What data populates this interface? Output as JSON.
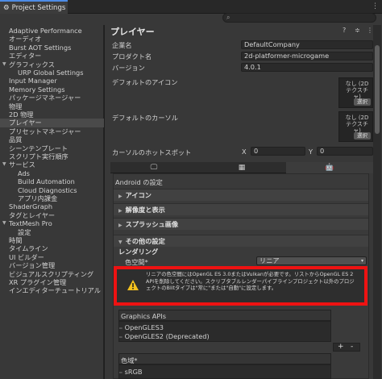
{
  "window": {
    "title": "Project Settings",
    "menu_icon": "kebab-menu-icon"
  },
  "search": {
    "placeholder": "",
    "icon": "search-icon"
  },
  "sidebar": {
    "items": [
      {
        "label": "Adaptive Performance",
        "indent": 0
      },
      {
        "label": "オーディオ",
        "indent": 0
      },
      {
        "label": "Burst AOT Settings",
        "indent": 0
      },
      {
        "label": "エディター",
        "indent": 0
      },
      {
        "label": "グラフィックス",
        "indent": 0,
        "expanded": true
      },
      {
        "label": "URP Global Settings",
        "indent": 2
      },
      {
        "label": "Input Manager",
        "indent": 0
      },
      {
        "label": "Memory Settings",
        "indent": 0
      },
      {
        "label": "パッケージマネージャー",
        "indent": 0
      },
      {
        "label": "物理",
        "indent": 0
      },
      {
        "label": "2D 物理",
        "indent": 0
      },
      {
        "label": "プレイヤー",
        "indent": 0,
        "active": true
      },
      {
        "label": "プリセットマネージャー",
        "indent": 0
      },
      {
        "label": "品質",
        "indent": 0
      },
      {
        "label": "シーンテンプレート",
        "indent": 0
      },
      {
        "label": "スクリプト実行順序",
        "indent": 0
      },
      {
        "label": "サービス",
        "indent": 0,
        "expanded": true
      },
      {
        "label": "Ads",
        "indent": 2
      },
      {
        "label": "Build Automation",
        "indent": 2
      },
      {
        "label": "Cloud Diagnostics",
        "indent": 2
      },
      {
        "label": "アプリ内課金",
        "indent": 2
      },
      {
        "label": "ShaderGraph",
        "indent": 0
      },
      {
        "label": "タグとレイヤー",
        "indent": 0
      },
      {
        "label": "TextMesh Pro",
        "indent": 0,
        "expanded": true
      },
      {
        "label": "設定",
        "indent": 2
      },
      {
        "label": "時間",
        "indent": 0
      },
      {
        "label": "タイムライン",
        "indent": 0
      },
      {
        "label": "UI ビルダー",
        "indent": 0
      },
      {
        "label": "バージョン管理",
        "indent": 0
      },
      {
        "label": "ビジュアルスクリプティング",
        "indent": 0
      },
      {
        "label": "XR プラグイン管理",
        "indent": 0
      },
      {
        "label": "インエディターチュートリアル",
        "indent": 0
      }
    ]
  },
  "main": {
    "title": "プレイヤー",
    "header_icons": [
      "help-icon",
      "preset-icon",
      "kebab-menu-icon"
    ],
    "company_label": "企業名",
    "company_value": "DefaultCompany",
    "product_label": "プロダクト名",
    "product_value": "2d-platformer-microgame",
    "version_label": "バージョン",
    "version_value": "4.0.1",
    "default_icon_label": "デフォルトのアイコン",
    "default_cursor_label": "デフォルトのカーソル",
    "texture_none": "なし (2D テクスチャ)",
    "select_label": "選択",
    "hotspot_label": "カーソルのホットスポット",
    "x_label": "X",
    "x_value": "0",
    "y_label": "Y",
    "y_value": "0",
    "platform_tabs": [
      "desktop-icon",
      "webgl-icon",
      "android-icon"
    ],
    "android_settings": "Android の設定",
    "sections": {
      "icon": "アイコン",
      "resolution": "解像度と表示",
      "splash": "スプラッシュ画像",
      "other": "その他の設定"
    },
    "rendering": "レンダリング",
    "color_space_label": "色空間*",
    "color_space_value": "リニア",
    "warning": "リニアの色空間にはOpenGL ES 3.0またはVulkanが必要です。リストからOpenGL ES 2 APIを削除してください。スクリプタブルレンダーパイプラインプロジェクト以外のプロジェクトのBlitタイプは\"常に\"または\"自動\"に設定します。",
    "graphics_apis_label": "Graphics APIs",
    "graphics_apis": [
      "OpenGLES3",
      "OpenGLES2 (Deprecated)"
    ],
    "add_btn": "+",
    "remove_btn": "-",
    "color_gamut_label": "色域*",
    "color_gamut": [
      "sRGB"
    ]
  }
}
